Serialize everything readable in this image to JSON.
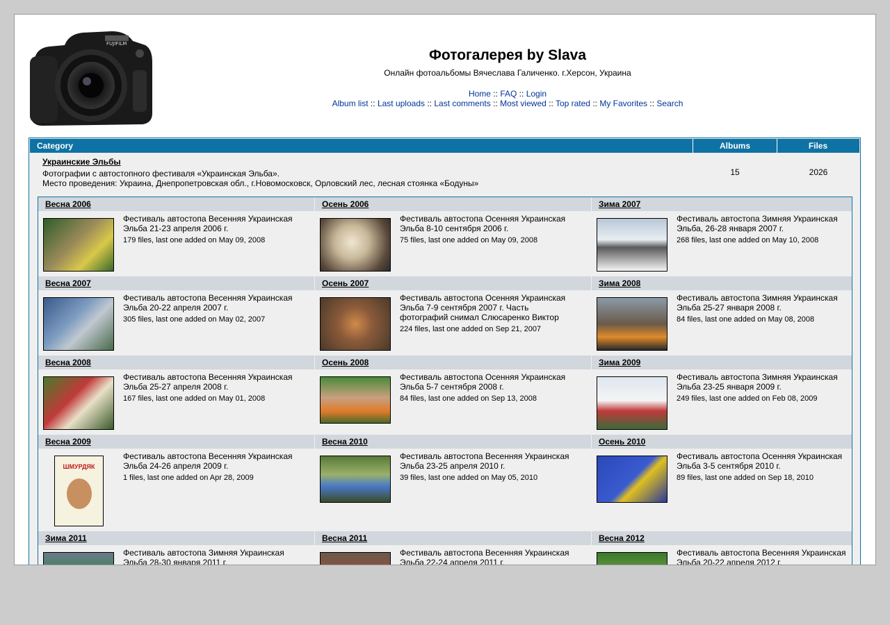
{
  "header": {
    "title": "Фотогалерея by Slava",
    "description": "Онлайн фотоальбомы Вячеслава Галиченко. г.Херсон, Украина",
    "nav_top": [
      "Home",
      "FAQ",
      "Login"
    ],
    "nav_bottom": [
      "Album list",
      "Last uploads",
      "Last comments",
      "Most viewed",
      "Top rated",
      "My Favorites",
      "Search"
    ],
    "separator": "::",
    "logo_icon": "camera-logo-icon"
  },
  "table": {
    "headers": {
      "category": "Category",
      "albums": "Albums",
      "files": "Files"
    },
    "category": {
      "name": "Украинские Эльбы",
      "desc1": "Фотографии с автостопного фестиваля «Украинская Эльба».",
      "desc2": "Место проведения: Украина, Днепропетровская обл., г.Новомосковск, Орловский лес, лесная стоянка «Бодуны»",
      "albums": "15",
      "files": "2026"
    }
  },
  "albums": [
    {
      "title": "Весна 2006",
      "desc": "Фестиваль автостопа Весенняя Украинская Эльба 21-23 апреля 2006 г.",
      "info": "179 files, last one added on May 09, 2008"
    },
    {
      "title": "Осень 2006",
      "desc": "Фестиваль автостопа Осенняя Украинская Эльба 8-10 сентября 2006 г.",
      "info": "75 files, last one added on May 09, 2008"
    },
    {
      "title": "Зима 2007",
      "desc": "Фестиваль автостопа Зимняя Украинская Эльба, 26-28 января 2007 г.",
      "info": "268 files, last one added on May 10, 2008"
    },
    {
      "title": "Весна 2007",
      "desc": "Фестиваль автостопа Весенняя Украинская Эльба 20-22 апреля 2007 г.",
      "info": "305 files, last one added on May 02, 2007"
    },
    {
      "title": "Осень 2007",
      "desc": "Фестиваль автостопа Осенняя Украинская Эльба 7-9 сентября 2007 г. Часть фотографий снимал Слюсаренко Виктор",
      "info": "224 files, last one added on Sep 21, 2007"
    },
    {
      "title": "Зима 2008",
      "desc": "Фестиваль автостопа Зимняя Украинская Эльба 25-27 января 2008 г.",
      "info": "84 files, last one added on May 08, 2008"
    },
    {
      "title": "Весна 2008",
      "desc": "Фестиваль автостопа Весенняя Украинская Эльба 25-27 апреля 2008 г.",
      "info": "167 files, last one added on May 01, 2008"
    },
    {
      "title": "Осень 2008",
      "desc": "Фестиваль автостопа Осенняя Украинская Эльба 5-7 сентября 2008 г.",
      "info": "84 files, last one added on Sep 13, 2008"
    },
    {
      "title": "Зима 2009",
      "desc": "Фестиваль автостопа Зимняя Украинская Эльба 23-25 января 2009 г.",
      "info": "249 files, last one added on Feb 08, 2009"
    },
    {
      "title": "Весна 2009",
      "desc": "Фестиваль автостопа Весенняя Украинская Эльба 24-26 апреля 2009 г.",
      "info": "1 files, last one added on Apr 28, 2009",
      "thumb_text": "ШМУРДЯК"
    },
    {
      "title": "Весна 2010",
      "desc": "Фестиваль автостопа Весенняя Украинская Эльба 23-25 апреля 2010 г.",
      "info": "39 files, last one added on May 05, 2010"
    },
    {
      "title": "Осень 2010",
      "desc": "Фестиваль автостопа Осенняя Украинская Эльба 3-5 сентября 2010 г.",
      "info": "89 files, last one added on Sep 18, 2010"
    },
    {
      "title": "Зима 2011",
      "desc": "Фестиваль автостопа Зимняя Украинская Эльба 28-30 января 2011 г.",
      "info": ""
    },
    {
      "title": "Весна 2011",
      "desc": "Фестиваль автостопа Весенняя Украинская Эльба 22-24 апреля 2011 г.",
      "info": ""
    },
    {
      "title": "Весна 2012",
      "desc": "Фестиваль автостопа Весенняя Украинская Эльба 20-22 апреля 2012 г.",
      "info": ""
    }
  ],
  "colors": {
    "page_bg": "#cccccc",
    "header_bar": "#0e72a4",
    "album_title_bg": "#d1d7dc",
    "cell_bg": "#efefef",
    "link": "#003399"
  }
}
